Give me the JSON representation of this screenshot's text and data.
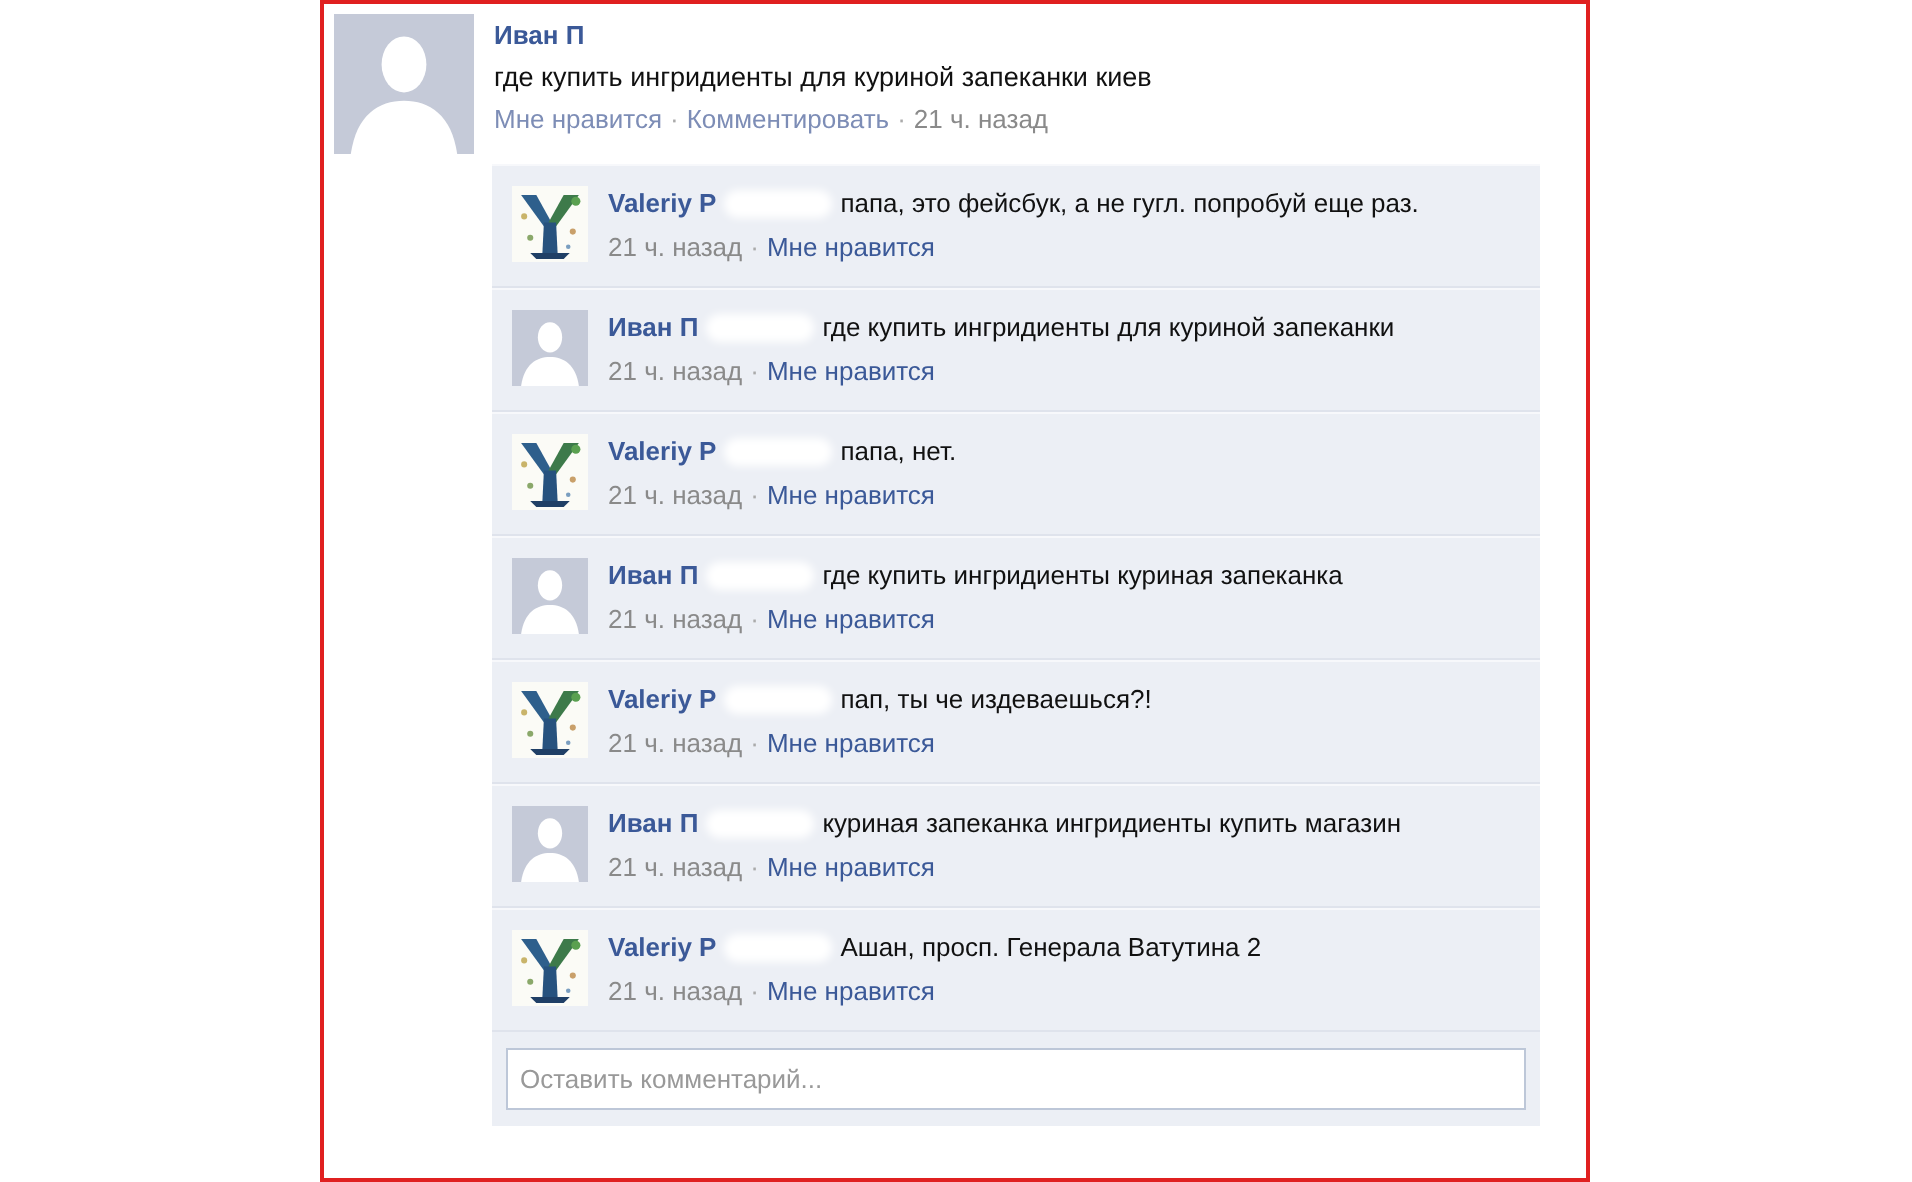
{
  "post": {
    "author": "Иван П",
    "avatar": {
      "kind": "silhouette"
    },
    "text": "где купить ингридиенты для куриной запеканки киев",
    "meta": [
      {
        "text": "Мне нравится",
        "kind": "link"
      },
      {
        "text": "·",
        "kind": "separator"
      },
      {
        "text": "Комментировать",
        "kind": "link"
      },
      {
        "text": "·",
        "kind": "separator"
      },
      {
        "text": "21 ч. назад",
        "kind": "time"
      }
    ]
  },
  "comments": [
    {
      "author": "Valeriy P",
      "redacted": true,
      "text": "папа, это фейсбук, а не гугл. попробуй еще раз.",
      "meta": [
        {
          "text": "21 ч. назад",
          "kind": "time"
        },
        {
          "text": "·",
          "kind": "separator"
        },
        {
          "text": "Мне нравится",
          "kind": "like"
        }
      ]
    },
    {
      "author": "Иван П",
      "avatar": {
        "kind": "silhouette"
      },
      "redacted": true,
      "text": "где купить ингридиенты для куриной запеканки",
      "meta": [
        {
          "text": "21 ч. назад",
          "kind": "time"
        },
        {
          "text": "·",
          "kind": "separator"
        },
        {
          "text": "Мне нравится",
          "kind": "like"
        }
      ]
    },
    {
      "author": "Valeriy P",
      "redacted": true,
      "text": "папа, нет.",
      "meta": [
        {
          "text": "21 ч. назад",
          "kind": "time"
        },
        {
          "text": "·",
          "kind": "separator"
        },
        {
          "text": "Мне нравится",
          "kind": "like"
        }
      ]
    },
    {
      "author": "Иван П",
      "avatar": {
        "kind": "silhouette"
      },
      "redacted": true,
      "text": "где купить ингридиенты куриная запеканка",
      "meta": [
        {
          "text": "21 ч. назад",
          "kind": "time"
        },
        {
          "text": "·",
          "kind": "separator"
        },
        {
          "text": "Мне нравится",
          "kind": "like"
        }
      ]
    },
    {
      "author": "Valeriy P",
      "redacted": true,
      "text": "пап, ты че издеваешься?!",
      "meta": [
        {
          "text": "21 ч. назад",
          "kind": "time"
        },
        {
          "text": "·",
          "kind": "separator"
        },
        {
          "text": "Мне нравится",
          "kind": "like"
        }
      ]
    },
    {
      "author": "Иван П",
      "avatar": {
        "kind": "silhouette"
      },
      "redacted": true,
      "text": "куриная запеканка ингридиенты купить магазин",
      "meta": [
        {
          "text": "21 ч. назад",
          "kind": "time"
        },
        {
          "text": "·",
          "kind": "separator"
        },
        {
          "text": "Мне нравится",
          "kind": "like"
        }
      ]
    },
    {
      "author": "Valeriy P",
      "redacted": true,
      "text": "Ашан,  просп. Генерала Ватутина 2",
      "meta": [
        {
          "text": "21 ч. назад",
          "kind": "time"
        },
        {
          "text": "·",
          "kind": "separator"
        },
        {
          "text": "Мне нравится",
          "kind": "like"
        }
      ]
    }
  ],
  "comment_field": {
    "placeholder": "Оставить комментарий..."
  }
}
